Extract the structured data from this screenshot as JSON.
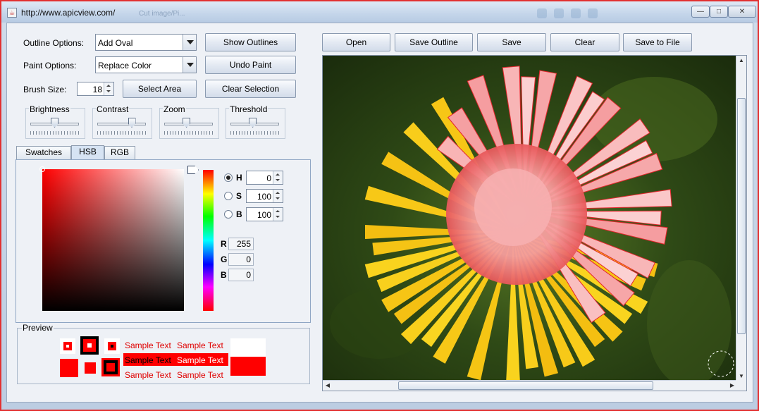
{
  "window": {
    "title": "http://www.apicview.com/",
    "ghost_title": "Cut image/Pi...",
    "buttons": {
      "minimize": "—",
      "maximize": "□",
      "close": "✕"
    }
  },
  "controls": {
    "outline_label": "Outline Options:",
    "outline_value": "Add Oval",
    "paint_label": "Paint Options:",
    "paint_value": "Replace Color",
    "brush_label": "Brush Size:",
    "brush_value": "18",
    "show_outlines": "Show Outlines",
    "undo_paint": "Undo Paint",
    "select_area": "Select Area",
    "clear_selection": "Clear Selection"
  },
  "sliders": [
    {
      "label": "Brightness",
      "level": 0.5
    },
    {
      "label": "Contrast",
      "level": 0.75
    },
    {
      "label": "Zoom",
      "level": 0.45
    },
    {
      "label": "Threshold",
      "level": 0.45
    }
  ],
  "tabs": {
    "swatches": "Swatches",
    "hsb": "HSB",
    "rgb": "RGB",
    "active": "HSB"
  },
  "hsb": {
    "h_label": "H",
    "h_value": "0",
    "s_label": "S",
    "s_value": "100",
    "b_label": "B",
    "b_value": "100",
    "selected": "H"
  },
  "rgb": {
    "r_label": "R",
    "r_value": "255",
    "g_label": "G",
    "g_value": "0",
    "b_label": "B",
    "b_value": "0"
  },
  "preview": {
    "label": "Preview",
    "sample_text": "Sample Text",
    "color": "#ff0000"
  },
  "toolbar": {
    "open": "Open",
    "save_outline": "Save Outline",
    "save": "Save",
    "clear": "Clear",
    "save_to_file": "Save to File"
  },
  "image": {
    "subject": "dandelion flower, partly recolored pink/red",
    "accent_color": "#ff0000"
  }
}
